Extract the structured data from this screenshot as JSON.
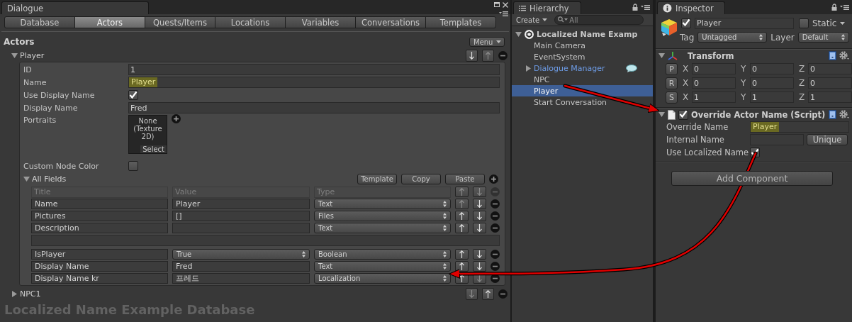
{
  "dialogue_editor": {
    "window_tab": "Dialogue",
    "tabs": [
      {
        "label": "Database",
        "selected": false
      },
      {
        "label": "Actors",
        "selected": true
      },
      {
        "label": "Quests/Items",
        "selected": false
      },
      {
        "label": "Locations",
        "selected": false
      },
      {
        "label": "Variables",
        "selected": false
      },
      {
        "label": "Conversations",
        "selected": false
      },
      {
        "label": "Templates",
        "selected": false
      }
    ],
    "section_title": "Actors",
    "menu_button": "Menu",
    "actors": [
      {
        "name": "Player",
        "expanded": true,
        "fields": [
          {
            "kind": "text",
            "label": "ID",
            "value": "1",
            "highlighted": false
          },
          {
            "kind": "text",
            "label": "Name",
            "value": "Player",
            "highlighted": true
          },
          {
            "kind": "checkbox",
            "label": "Use Display Name",
            "checked": true
          },
          {
            "kind": "text",
            "label": "Display Name",
            "value": "Fred",
            "highlighted": false
          },
          {
            "kind": "portrait",
            "label": "Portraits",
            "slot_text": "None (Texture 2D)",
            "slot_button": "Select"
          },
          {
            "kind": "checkbox",
            "label": "Custom Node Color",
            "checked": false
          }
        ],
        "all_fields": {
          "label": "All Fields",
          "expanded": true,
          "buttons": [
            "Template",
            "Copy",
            "Paste"
          ],
          "columns": [
            "Title",
            "Value",
            "Type"
          ],
          "rows": [
            {
              "kind": "field",
              "title": "Name",
              "value": "Player",
              "type": "Text"
            },
            {
              "kind": "field",
              "title": "Pictures",
              "value": "[]",
              "type": "Files"
            },
            {
              "kind": "field",
              "title": "Description",
              "type": "Text"
            },
            {
              "kind": "text_area"
            },
            {
              "kind": "choice",
              "title": "IsPlayer",
              "value": "True",
              "type": "Boolean"
            },
            {
              "kind": "field",
              "title": "Display Name",
              "value": "Fred",
              "type": "Text"
            },
            {
              "kind": "field",
              "title": "Display Name kr",
              "value": "프레드",
              "type": "Localization"
            }
          ]
        }
      },
      {
        "name": "NPC1",
        "expanded": false
      }
    ],
    "footer": "Localized Name Example Database"
  },
  "hierarchy": {
    "tab": "Hierarchy",
    "create_button": "Create",
    "search_placeholder": "All",
    "scene": {
      "name": "Localized Name Examp",
      "expanded": true,
      "children": [
        {
          "label": "Main Camera",
          "selected": false,
          "kind": "object"
        },
        {
          "label": "EventSystem",
          "selected": false,
          "kind": "object"
        },
        {
          "label": "Dialogue Manager",
          "selected": false,
          "kind": "prefab",
          "expanded": false,
          "gizmo": true
        },
        {
          "label": "NPC",
          "selected": false,
          "kind": "object"
        },
        {
          "label": "Player",
          "selected": true,
          "kind": "object"
        },
        {
          "label": "Start Conversation",
          "selected": false,
          "kind": "object"
        }
      ]
    }
  },
  "inspector": {
    "tab": "Inspector",
    "object": {
      "active": true,
      "name": "Player",
      "static": false,
      "static_label": "Static",
      "tag_label": "Tag",
      "tag": "Untagged",
      "layer_label": "Layer",
      "layer": "Default"
    },
    "components": [
      {
        "kind": "transform",
        "title": "Transform",
        "expanded": true,
        "rows": [
          {
            "button": "P",
            "values": [
              {
                "axis": "X",
                "value": "0"
              },
              {
                "axis": "Y",
                "value": "0"
              },
              {
                "axis": "Z",
                "value": "0"
              }
            ]
          },
          {
            "button": "R",
            "values": [
              {
                "axis": "X",
                "value": "0"
              },
              {
                "axis": "Y",
                "value": "0"
              },
              {
                "axis": "Z",
                "value": "0"
              }
            ]
          },
          {
            "button": "S",
            "values": [
              {
                "axis": "X",
                "value": "1"
              },
              {
                "axis": "Y",
                "value": "1"
              },
              {
                "axis": "Z",
                "value": "1"
              }
            ]
          }
        ]
      },
      {
        "kind": "script",
        "title": "Override Actor Name (Script)",
        "expanded": true,
        "enabled": true,
        "fields": [
          {
            "kind": "text",
            "label": "Override Name",
            "value": "Player",
            "highlighted": true
          },
          {
            "kind": "text_button",
            "label": "Internal Name",
            "button": "Unique",
            "highlighted": false
          },
          {
            "kind": "checkbox",
            "label": "Use Localized Name",
            "checked": true
          }
        ]
      }
    ],
    "add_component_button": "Add Component"
  }
}
